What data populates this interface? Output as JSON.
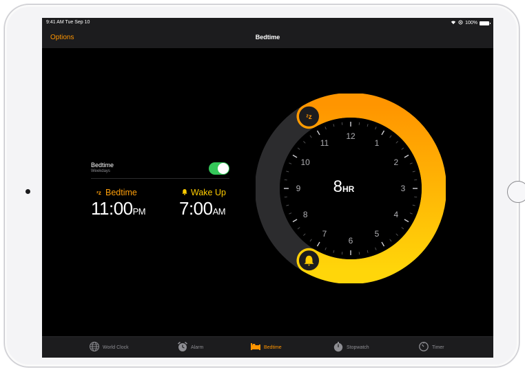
{
  "status_bar": {
    "time": "9:41 AM  Tue Sep 10",
    "battery": "100%"
  },
  "nav": {
    "left_button": "Options",
    "title": "Bedtime"
  },
  "settings": {
    "bedtime_label": "Bedtime",
    "bedtime_sub": "Weekdays",
    "toggle_on": true
  },
  "times": {
    "bedtime_label": "Bedtime",
    "bedtime_time": "11:00",
    "bedtime_ampm": "PM",
    "wake_label": "Wake Up",
    "wake_time": "7:00",
    "wake_ampm": "AM"
  },
  "dial": {
    "hours_value": "8",
    "hours_unit": "HR",
    "numbers": [
      "12",
      "1",
      "2",
      "3",
      "4",
      "5",
      "6",
      "7",
      "8",
      "9",
      "10",
      "11"
    ],
    "bedtime_hour": 23,
    "wake_hour": 7
  },
  "tabs": [
    {
      "label": "World Clock",
      "icon": "globe-icon",
      "active": false
    },
    {
      "label": "Alarm",
      "icon": "alarm-clock-icon",
      "active": false
    },
    {
      "label": "Bedtime",
      "icon": "bed-icon",
      "active": true
    },
    {
      "label": "Stopwatch",
      "icon": "stopwatch-icon",
      "active": false
    },
    {
      "label": "Timer",
      "icon": "timer-icon",
      "active": false
    }
  ],
  "colors": {
    "accent": "#ff9500",
    "toggle": "#34c759",
    "arc_start": "#ff9500",
    "arc_end": "#ffd60a"
  }
}
